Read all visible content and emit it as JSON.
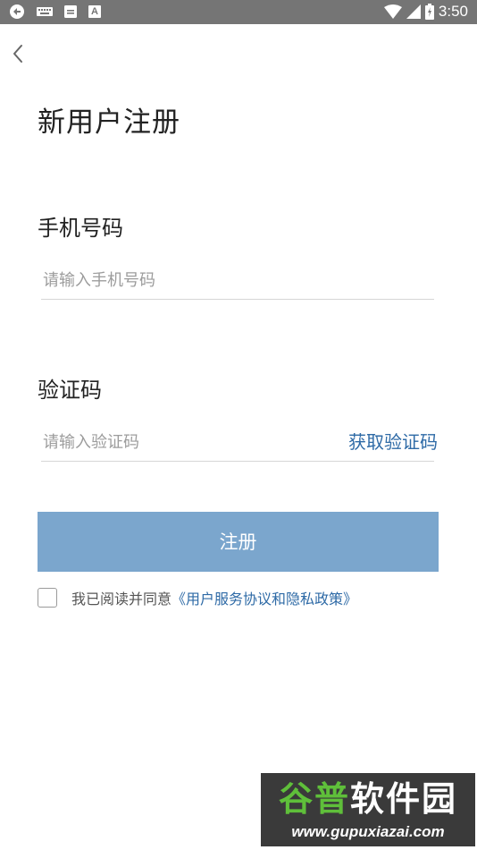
{
  "status_bar": {
    "left_icons": [
      "sync-icon",
      "keyboard-icon",
      "mail-icon",
      "a-icon"
    ],
    "a_icon_text": "A",
    "right_icons": [
      "wifi-icon",
      "signal-icon",
      "battery-icon"
    ],
    "time": "3:50"
  },
  "header": {
    "back_icon": "chevron-left-icon",
    "title": "新用户注册"
  },
  "phone": {
    "label": "手机号码",
    "placeholder": "请输入手机号码",
    "value": ""
  },
  "code": {
    "label": "验证码",
    "placeholder": "请输入验证码",
    "value": "",
    "get_code_label": "获取验证码"
  },
  "register_button": {
    "label": "注册"
  },
  "agreement": {
    "checked": false,
    "text": "我已阅读并同意",
    "link": "《用户服务协议和隐私政策》"
  },
  "watermark": {
    "text_part1": "谷普",
    "text_part2": "软件园",
    "url": "www.gupuxiazai.com"
  },
  "colors": {
    "status_bar": "#757575",
    "accent": "#2e6aa6",
    "button": "#7ba6cd"
  }
}
